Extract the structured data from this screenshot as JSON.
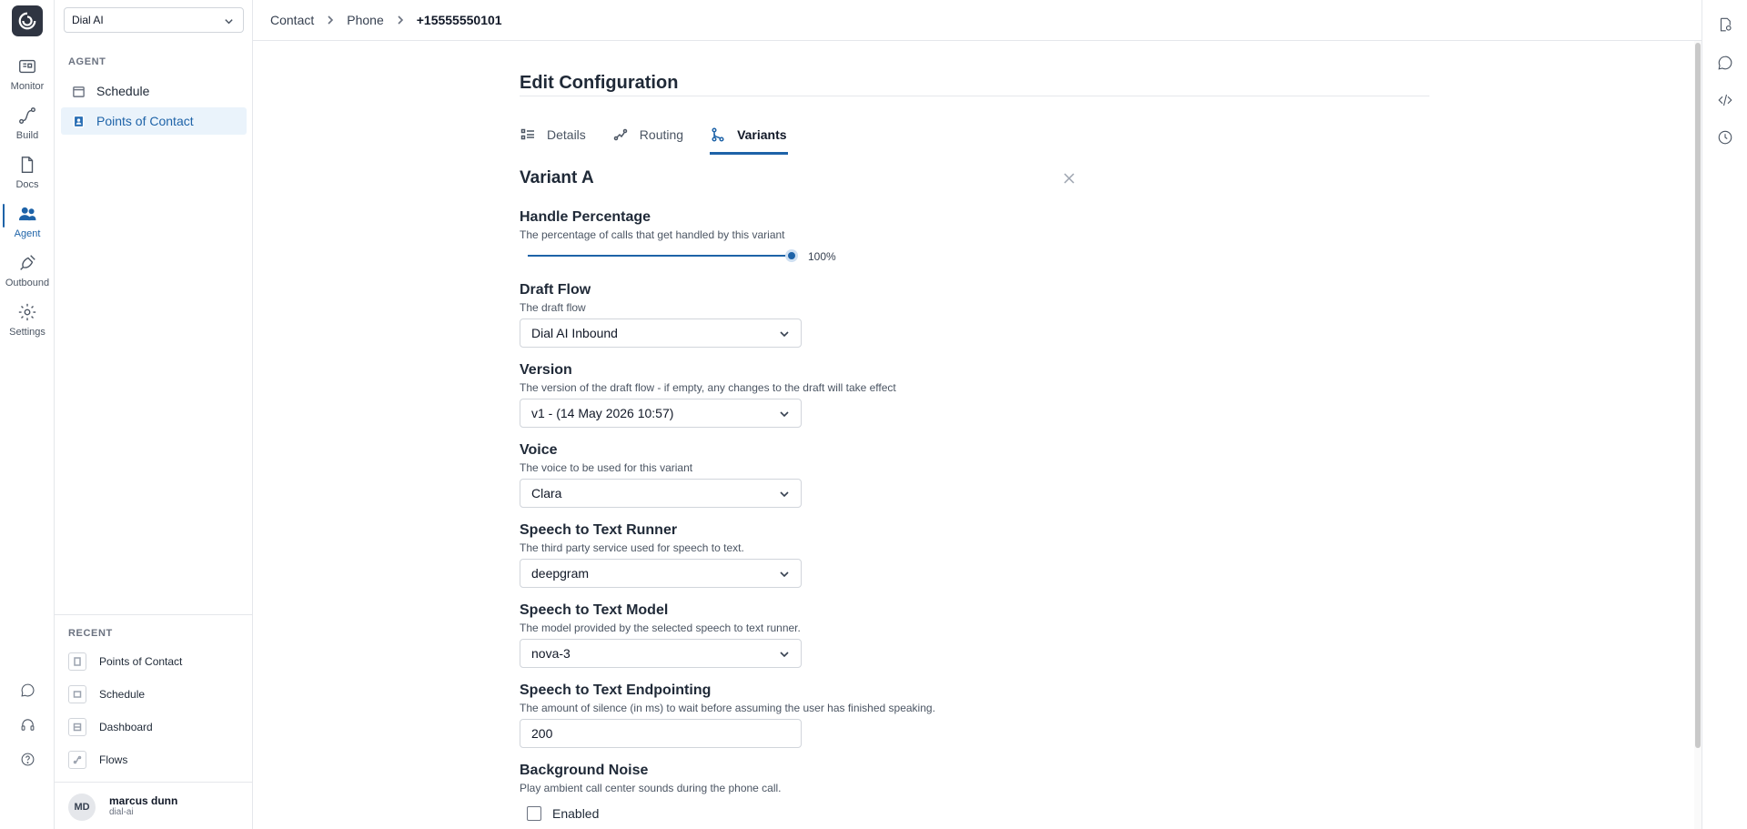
{
  "org_select": {
    "value": "Dial AI"
  },
  "rail": {
    "items": [
      {
        "label": "Monitor",
        "icon": "monitor-icon"
      },
      {
        "label": "Build",
        "icon": "build-icon"
      },
      {
        "label": "Docs",
        "icon": "docs-icon"
      },
      {
        "label": "Agent",
        "icon": "agent-icon",
        "active": true
      },
      {
        "label": "Outbound",
        "icon": "outbound-icon"
      },
      {
        "label": "Settings",
        "icon": "gear-icon"
      }
    ],
    "bottom_icons": [
      "chat-icon",
      "headset-icon",
      "help-icon"
    ]
  },
  "nav": {
    "section_label": "AGENT",
    "items": [
      {
        "label": "Schedule",
        "icon": "calendar-icon"
      },
      {
        "label": "Points of Contact",
        "icon": "contact-book-icon",
        "active": true
      }
    ]
  },
  "recent": {
    "label": "RECENT",
    "items": [
      {
        "label": "Points of Contact"
      },
      {
        "label": "Schedule"
      },
      {
        "label": "Dashboard"
      },
      {
        "label": "Flows"
      }
    ]
  },
  "user": {
    "initials": "MD",
    "name": "marcus dunn",
    "org": "dial-ai"
  },
  "breadcrumb": [
    "Contact",
    "Phone",
    "+15555550101"
  ],
  "page": {
    "title": "Edit Configuration",
    "tabs": [
      {
        "label": "Details",
        "icon": "details-icon"
      },
      {
        "label": "Routing",
        "icon": "routing-icon"
      },
      {
        "label": "Variants",
        "icon": "variants-icon",
        "active": true
      }
    ]
  },
  "variant": {
    "title": "Variant A",
    "handle_percentage": {
      "label": "Handle Percentage",
      "description": "The percentage of calls that get handled by this variant",
      "value": 100,
      "display": "100%"
    },
    "draft_flow": {
      "label": "Draft Flow",
      "description": "The draft flow",
      "value": "Dial AI Inbound"
    },
    "version": {
      "label": "Version",
      "description": "The version of the draft flow - if empty, any changes to the draft will take effect",
      "value": "v1 - (14 May 2026 10:57)"
    },
    "voice": {
      "label": "Voice",
      "description": "The voice to be used for this variant",
      "value": "Clara"
    },
    "stt_runner": {
      "label": "Speech to Text Runner",
      "description": "The third party service used for speech to text.",
      "value": "deepgram"
    },
    "stt_model": {
      "label": "Speech to Text Model",
      "description": "The model provided by the selected speech to text runner.",
      "value": "nova-3"
    },
    "stt_endpointing": {
      "label": "Speech to Text Endpointing",
      "description": "The amount of silence (in ms) to wait before assuming the user has finished speaking.",
      "value": "200"
    },
    "background_noise": {
      "label": "Background Noise",
      "description": "Play ambient call center sounds during the phone call.",
      "checkbox_label": "Enabled",
      "checked": false
    }
  },
  "colors": {
    "accent": "#1e63a8",
    "active_bg": "#eaf3fb",
    "logo_bg": "#2f3542"
  }
}
